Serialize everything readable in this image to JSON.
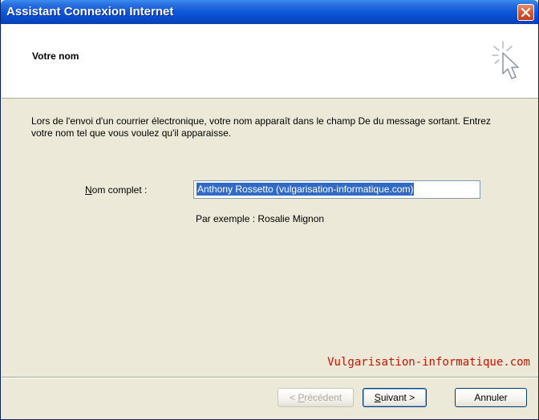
{
  "window": {
    "title": "Assistant Connexion Internet"
  },
  "header": {
    "title": "Votre nom",
    "icon": "wizard-cursor-icon"
  },
  "body": {
    "description": "Lors de l'envoi d'un courrier électronique, votre nom apparaît dans le champ De du message sortant. Entrez votre nom tel que vous voulez qu'il apparaisse.",
    "name_label_mnemonic": "N",
    "name_label_rest": "om complet :",
    "name_value": "Anthony Rossetto (vulgarisation-informatique.com)",
    "example": "Par exemple : Rosalie Mignon"
  },
  "watermark": "Vulgarisation-informatique.com",
  "buttons": {
    "prev_prefix": "< ",
    "prev_mnemonic": "P",
    "prev_rest": "récédent",
    "next_mnemonic": "S",
    "next_rest": "uivant >",
    "cancel": "Annuler"
  },
  "colors": {
    "titlebar": "#0a55d8",
    "selection": "#316ac5",
    "watermark": "#cc1100",
    "dialog_bg": "#ece9d8"
  }
}
